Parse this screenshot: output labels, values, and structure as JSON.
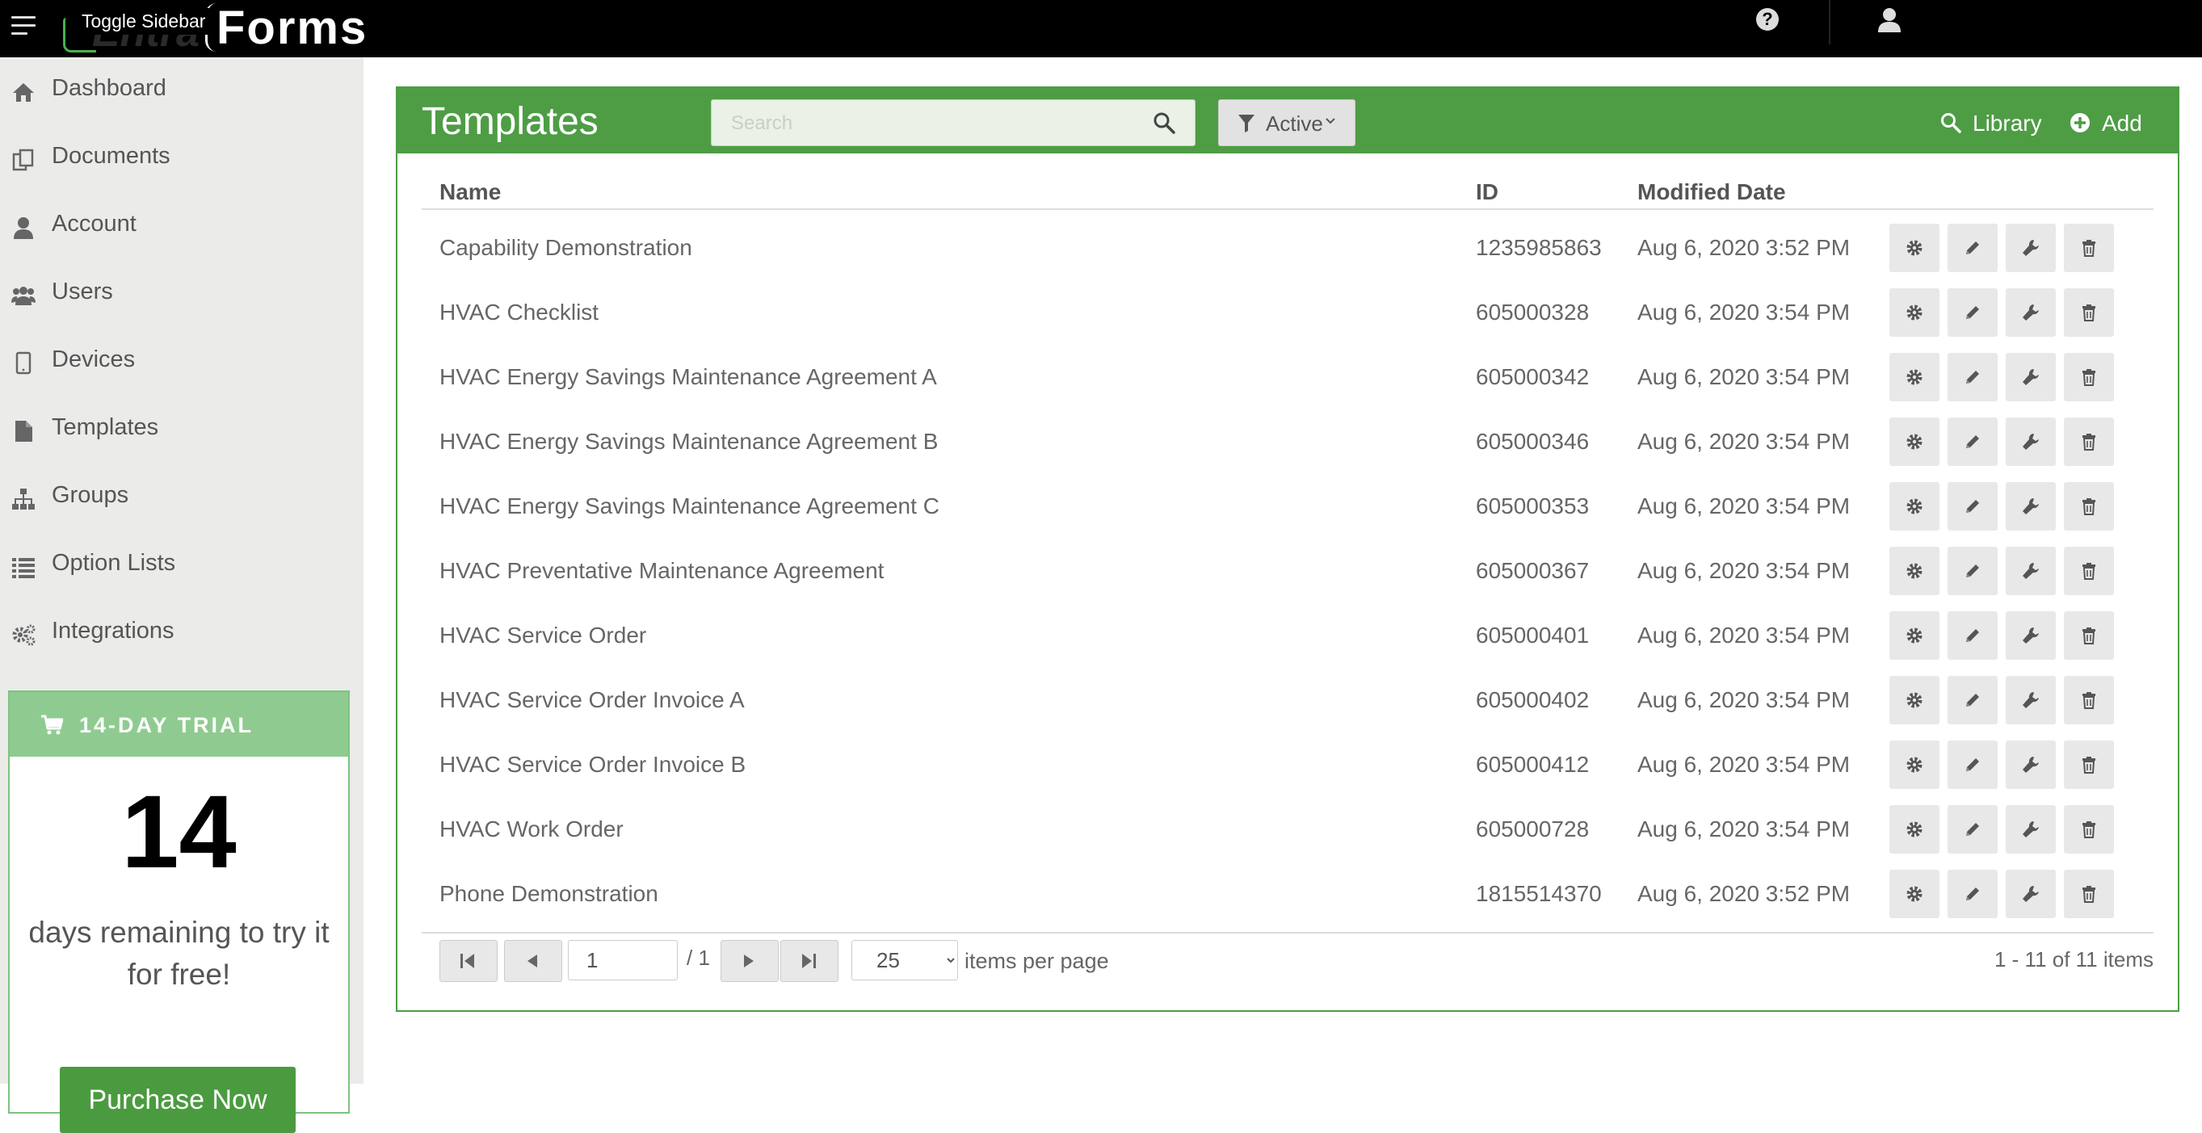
{
  "topbar": {
    "tooltip": "Toggle Sidebar",
    "logo_ghost": "Entra",
    "logo_text": "Forms",
    "help_symbol": "?"
  },
  "sidebar": {
    "items": [
      {
        "label": "Dashboard",
        "icon": "home-icon"
      },
      {
        "label": "Documents",
        "icon": "documents-icon"
      },
      {
        "label": "Account",
        "icon": "user-icon"
      },
      {
        "label": "Users",
        "icon": "users-icon"
      },
      {
        "label": "Devices",
        "icon": "tablet-icon"
      },
      {
        "label": "Templates",
        "icon": "file-icon"
      },
      {
        "label": "Groups",
        "icon": "sitemap-icon"
      },
      {
        "label": "Option Lists",
        "icon": "list-icon"
      },
      {
        "label": "Integrations",
        "icon": "gears-icon"
      }
    ],
    "trial": {
      "title": "14-DAY TRIAL",
      "count": "14",
      "text": "days remaining to try it for free!",
      "button": "Purchase Now"
    }
  },
  "main": {
    "title": "Templates",
    "search_placeholder": "Search",
    "filter_label": "Active",
    "library_label": "Library",
    "add_label": "Add",
    "columns": {
      "name": "Name",
      "id": "ID",
      "modified": "Modified Date"
    },
    "rows": [
      {
        "name": "Capability Demonstration",
        "id": "1235985863",
        "modified": "Aug 6, 2020 3:52 PM"
      },
      {
        "name": "HVAC Checklist",
        "id": "605000328",
        "modified": "Aug 6, 2020 3:54 PM"
      },
      {
        "name": "HVAC Energy Savings Maintenance Agreement A",
        "id": "605000342",
        "modified": "Aug 6, 2020 3:54 PM"
      },
      {
        "name": "HVAC Energy Savings Maintenance Agreement B",
        "id": "605000346",
        "modified": "Aug 6, 2020 3:54 PM"
      },
      {
        "name": "HVAC Energy Savings Maintenance Agreement C",
        "id": "605000353",
        "modified": "Aug 6, 2020 3:54 PM"
      },
      {
        "name": "HVAC Preventative Maintenance Agreement",
        "id": "605000367",
        "modified": "Aug 6, 2020 3:54 PM"
      },
      {
        "name": "HVAC Service Order",
        "id": "605000401",
        "modified": "Aug 6, 2020 3:54 PM"
      },
      {
        "name": "HVAC Service Order Invoice A",
        "id": "605000402",
        "modified": "Aug 6, 2020 3:54 PM"
      },
      {
        "name": "HVAC Service Order Invoice B",
        "id": "605000412",
        "modified": "Aug 6, 2020 3:54 PM"
      },
      {
        "name": "HVAC Work Order",
        "id": "605000728",
        "modified": "Aug 6, 2020 3:54 PM"
      },
      {
        "name": "Phone Demonstration",
        "id": "1815514370",
        "modified": "Aug 6, 2020 3:52 PM"
      }
    ],
    "pager": {
      "page": "1",
      "of_text": "/ 1",
      "per_page": "25",
      "per_page_options": [
        "25"
      ],
      "per_page_label": "items per page",
      "info": "1 - 11 of 11 items"
    }
  },
  "colors": {
    "brand_green": "#4e9d45",
    "trial_green": "#8fcb90",
    "topbar": "#000000",
    "sidebar_bg": "#ebebea"
  }
}
